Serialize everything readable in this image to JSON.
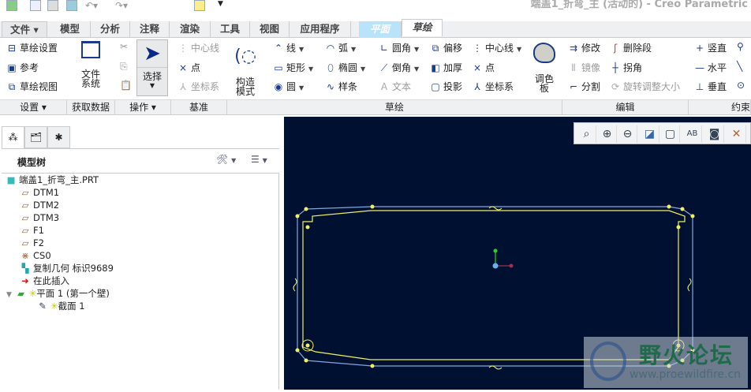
{
  "window": {
    "title": "端盖1_折弯_主 (活动的) - Creo Parametric"
  },
  "tabs": [
    {
      "label": "文件 ▾"
    },
    {
      "label": "模型"
    },
    {
      "label": "分析"
    },
    {
      "label": "注释"
    },
    {
      "label": "渲染"
    },
    {
      "label": "工具"
    },
    {
      "label": "视图"
    },
    {
      "label": "应用程序"
    },
    {
      "label": "平面"
    },
    {
      "label": "草绘"
    }
  ],
  "ribbon": {
    "setup": {
      "items": [
        "草绘设置",
        "参考",
        "草绘视图"
      ],
      "group": "设置 ▾"
    },
    "get_data": {
      "file_system": "文件\n系统",
      "group": "获取数据"
    },
    "operations": {
      "select": "选择",
      "group": "操作 ▾"
    },
    "datum": {
      "items": [
        "中心线",
        "点",
        "坐标系"
      ],
      "group": "基准"
    },
    "construction": "构造\n模式",
    "sketch": {
      "col1": [
        "线",
        "矩形",
        "圆"
      ],
      "col2": [
        "弧",
        "椭圆",
        "样条"
      ],
      "col3": [
        "圆角",
        "倒角",
        "文本"
      ],
      "col4": [
        "偏移",
        "加厚",
        "投影"
      ],
      "col5": [
        "中心线",
        "点",
        "坐标系"
      ],
      "palette": "调色\n板",
      "group": "草绘"
    },
    "edit": {
      "col1": [
        "修改",
        "镜像",
        "分割"
      ],
      "col2": [
        "删除段",
        "拐角",
        "旋转调整大小"
      ],
      "group": "编辑"
    },
    "constrain": {
      "items": [
        "竖直",
        "水平",
        "垂直"
      ],
      "group": "约束"
    }
  },
  "model_tree": {
    "title": "模型树",
    "items": [
      {
        "label": "端盖1_折弯_主.PRT",
        "icon": "part-icon"
      },
      {
        "label": "DTM1",
        "icon": "datum-plane-icon"
      },
      {
        "label": "DTM2",
        "icon": "datum-plane-icon"
      },
      {
        "label": "DTM3",
        "icon": "datum-plane-icon"
      },
      {
        "label": "F1",
        "icon": "datum-plane-icon"
      },
      {
        "label": "F2",
        "icon": "datum-plane-icon"
      },
      {
        "label": "CS0",
        "icon": "csys-icon"
      },
      {
        "label": "复制几何 标识9689",
        "icon": "copy-geom-icon"
      },
      {
        "label": "在此插入",
        "icon": "insert-arrow-icon"
      },
      {
        "label": "平面 1 (第一个壁)",
        "icon": "flat-wall-icon"
      },
      {
        "label": "截面 1",
        "icon": "sketch-icon"
      }
    ]
  },
  "watermark": {
    "title": "野火论坛",
    "url": "www.proewildfire.cn"
  }
}
